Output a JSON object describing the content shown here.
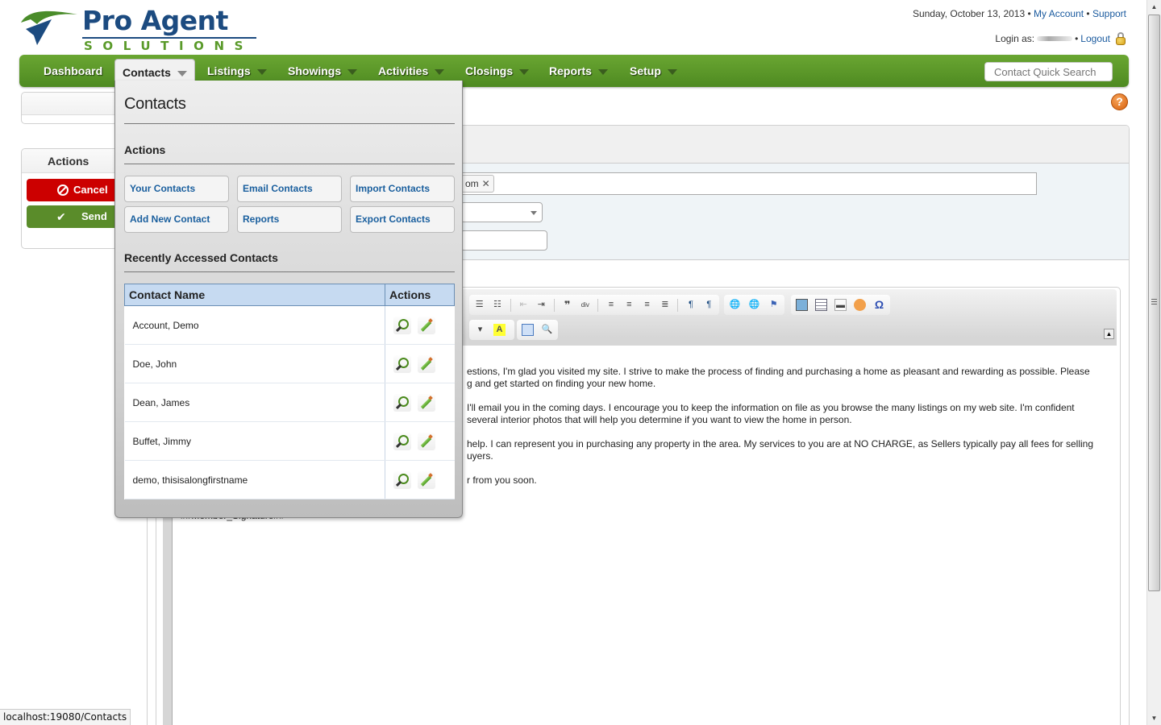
{
  "header": {
    "logo_text_top": "Pro Agent",
    "logo_text_bottom": "SOLUTIONS",
    "date": "Sunday, October 13, 2013",
    "separator": "•",
    "my_account": "My Account",
    "support": "Support",
    "login_as_label": "Login as:",
    "logout": "Logout"
  },
  "nav": {
    "items": [
      {
        "label": "Dashboard",
        "has_caret": false
      },
      {
        "label": "Contacts",
        "has_caret": true,
        "active": true
      },
      {
        "label": "Listings",
        "has_caret": true
      },
      {
        "label": "Showings",
        "has_caret": true
      },
      {
        "label": "Activities",
        "has_caret": true
      },
      {
        "label": "Closings",
        "has_caret": true
      },
      {
        "label": "Reports",
        "has_caret": true
      },
      {
        "label": "Setup",
        "has_caret": true
      }
    ],
    "quick_search_placeholder": "Contact Quick Search"
  },
  "help_icon": "?",
  "sidebar": {
    "actions_heading": "Actions",
    "cancel_label": "Cancel",
    "send_label": "Send"
  },
  "compose": {
    "to_token_visible_text": "om",
    "to_token_remove": "✕",
    "collapse_toolbar": "▲"
  },
  "editor": {
    "paragraphs": [
      [
        "estions, I'm glad you visited my site. I strive to make the process of finding and purchasing a home as pleasant and rewarding as possible. Please",
        "g and get started on finding your new home."
      ],
      [
        "I'll email you in the coming days. I encourage you to keep the information on file as you browse the many listings on my web site.  I'm confident",
        "several interior photos that will help you determine if you want to view the home in person."
      ],
      [
        "help. I can represent you in purchasing any property in the area.  My services to you are at NO CHARGE, as Sellers typically pay all fees for selling",
        "uyers."
      ],
      [
        "r from you soon."
      ]
    ],
    "signature": "##Member_Signature##"
  },
  "contacts_menu": {
    "title": "Contacts",
    "actions_heading": "Actions",
    "action_buttons": [
      "Your Contacts",
      "Email Contacts",
      "Import Contacts",
      "Add New Contact",
      "Reports",
      "Export Contacts"
    ],
    "recent_heading": "Recently Accessed Contacts",
    "table": {
      "columns": [
        "Contact Name",
        "Actions"
      ],
      "rows": [
        "Account, Demo",
        "Doe, John",
        "Dean, James",
        "Buffet, Jimmy",
        "demo, thisisalongfirstname"
      ]
    }
  },
  "status_bar": {
    "url": "localhost:19080/Contacts"
  }
}
